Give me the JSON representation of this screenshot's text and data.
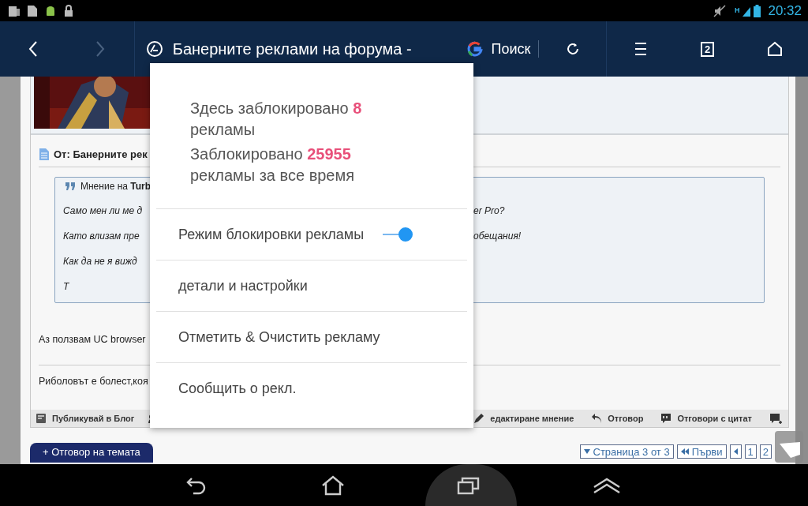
{
  "status_bar": {
    "network": "H",
    "time": "20:32"
  },
  "toolbar": {
    "forward_disabled": true,
    "title": "Банерните реклами на форума -",
    "search_label": "Поиск",
    "tab_count": "2"
  },
  "post": {
    "header": "От: Банерните рек",
    "quote": {
      "author_prefix": "Мнение на",
      "author": "Turb",
      "lines": [
        {
          "left": "Само мен ли ме д",
          "right": "er Pro?"
        },
        {
          "left": "Като влизам пре",
          "right": "обещания!"
        },
        {
          "left": "Как да не я вижд"
        },
        {
          "left": "Т"
        }
      ]
    },
    "paragraphs": [
      "Аз ползвам UC browser",
      "Риболовът е болест,коя"
    ],
    "footer_left": [
      {
        "kind": "blog",
        "label": "Публикувай в Блог"
      },
      {
        "kind": "people"
      }
    ],
    "footer_right": [
      {
        "kind": "edit",
        "label": "едактиране мнение"
      },
      {
        "kind": "reply",
        "label": "Отговор"
      },
      {
        "kind": "quote",
        "label": "Отговори с цитат"
      },
      {
        "kind": "multiquote"
      }
    ]
  },
  "reply_button": "+ Отговор на темата",
  "pagination": {
    "page_label": "Страница 3 от 3",
    "first": "Първи",
    "pages": [
      "1",
      "2"
    ]
  },
  "adblock_popup": {
    "stats": [
      "Здесь заблокировано **8** рекламы",
      "Заблокировано **25955** рекламы за все время"
    ],
    "toggle": {
      "label": "Режим блокировки рекламы",
      "on": true
    },
    "items": [
      "детали и настройки",
      "Отметить & Очистить рекламу",
      "Сообщить о рекл."
    ]
  },
  "nav_bar": [
    {
      "kind": "back",
      "selected": false
    },
    {
      "kind": "home",
      "selected": false
    },
    {
      "kind": "recents",
      "selected": true
    },
    {
      "kind": "up",
      "selected": false
    }
  ]
}
